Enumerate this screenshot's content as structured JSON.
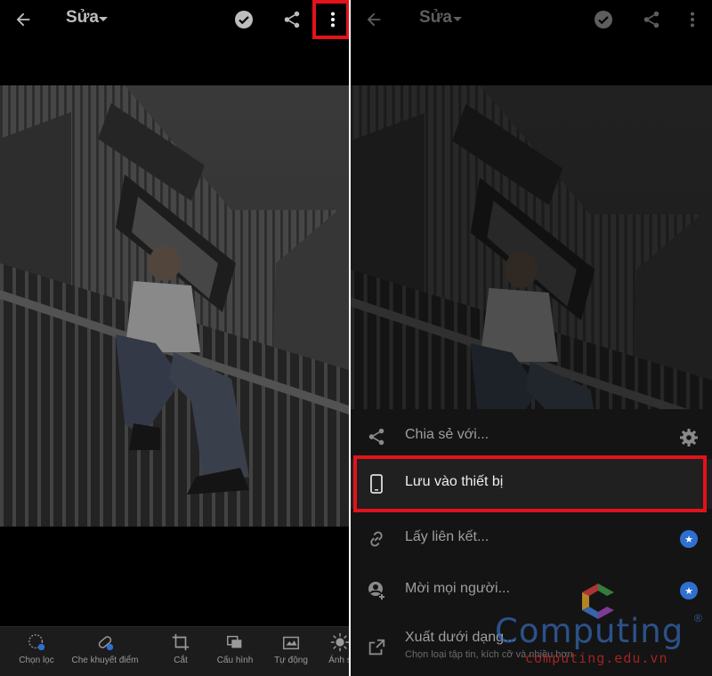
{
  "left_screen": {
    "title": "Sửa",
    "icons": [
      "back-arrow-icon",
      "dropdown-caret-icon",
      "check-circle-icon",
      "share-icon",
      "more-vert-icon"
    ],
    "toolbar": [
      {
        "label": "Chọn lọc",
        "icon": "selective-icon"
      },
      {
        "label": "Che khuyết điểm",
        "icon": "healing-icon"
      },
      {
        "label": "Cắt",
        "icon": "crop-icon"
      },
      {
        "label": "Cấu hình",
        "icon": "profiles-icon"
      },
      {
        "label": "Tự động",
        "icon": "auto-icon"
      },
      {
        "label": "Ánh s",
        "icon": "light-icon"
      }
    ]
  },
  "right_screen": {
    "title": "Sửa",
    "menu": [
      {
        "label": "Chia sẻ với...",
        "icon": "share-icon",
        "trailing": "gear-icon"
      },
      {
        "label": "Lưu vào thiết bị",
        "icon": "phone-icon",
        "highlighted": true
      },
      {
        "label": "Lấy liên kết...",
        "icon": "link-icon",
        "trailing": "star-badge"
      },
      {
        "label": "Mời mọi người...",
        "icon": "add-person-icon",
        "trailing": "star-badge"
      },
      {
        "label": "Xuất dưới dạng...",
        "sub": "Chọn loại tập tin, kích cỡ và nhiều hơn",
        "icon": "export-icon"
      }
    ]
  },
  "watermark": {
    "brand": "Computing",
    "url": "computing.edu.vn",
    "registered": "®"
  },
  "colors": {
    "highlight": "#e3121b",
    "badge": "#2f6fd0",
    "sheet": "#141414"
  }
}
